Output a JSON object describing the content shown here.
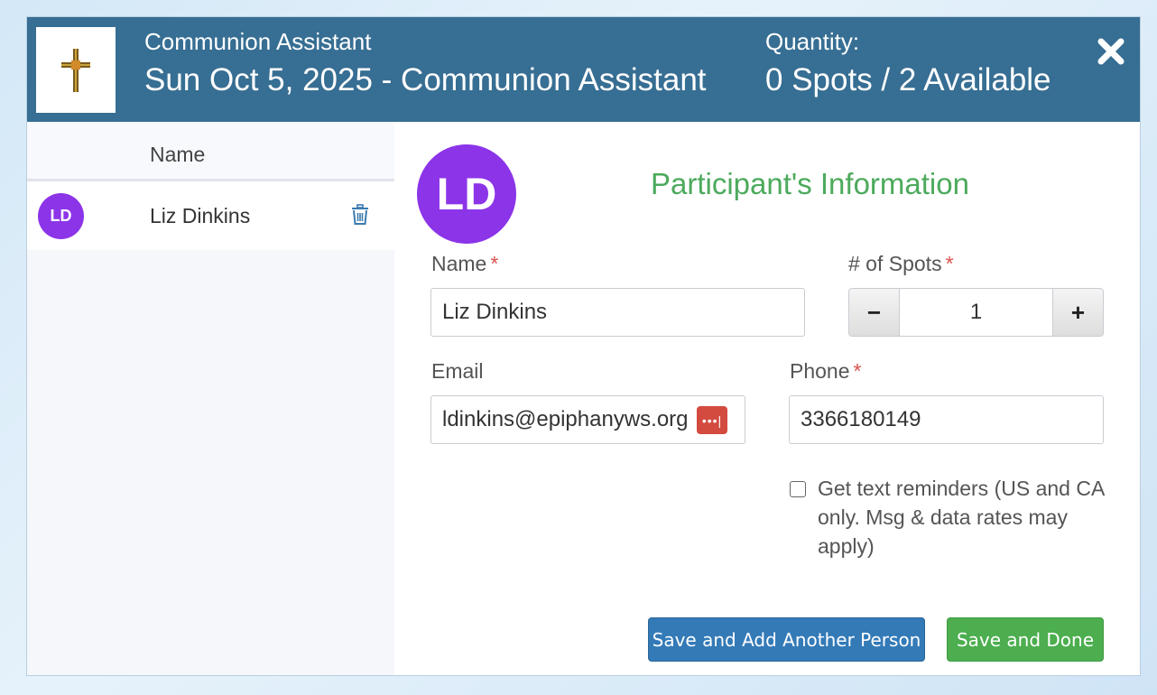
{
  "header": {
    "role": "Communion Assistant",
    "title": "Sun Oct 5, 2025 - Communion Assistant",
    "quantity_label": "Quantity:",
    "quantity_value": "0 Spots / 2 Available"
  },
  "icons": {
    "logo": "cross-logo-icon",
    "close": "close-icon",
    "trash": "trash-icon",
    "password_manager": "password-manager-icon"
  },
  "sidebar": {
    "column_header": "Name",
    "participants": [
      {
        "initials": "LD",
        "name": "Liz Dinkins"
      }
    ]
  },
  "form": {
    "avatar_initials": "LD",
    "title": "Participant's Information",
    "name_label": "Name",
    "name_value": "Liz Dinkins",
    "spots_label": "# of Spots",
    "spots_value": "1",
    "minus_label": "−",
    "plus_label": "+",
    "email_label": "Email",
    "email_value": "ldinkins@epiphanyws.org",
    "phone_label": "Phone",
    "phone_value": "3366180149",
    "required_mark": "*",
    "password_badge": "•••|",
    "reminder_label": "Get text reminders (US and CA only. Msg & data rates may apply)",
    "reminder_checked": false
  },
  "buttons": {
    "save_add": "Save and Add Another Person",
    "save_done": "Save and Done"
  },
  "colors": {
    "header_bg": "#376e93",
    "avatar_bg": "#8c34e8",
    "title_green": "#4caa5c",
    "required_red": "#d9534f",
    "primary_blue": "#337ab7",
    "success_green": "#4cae4f"
  }
}
